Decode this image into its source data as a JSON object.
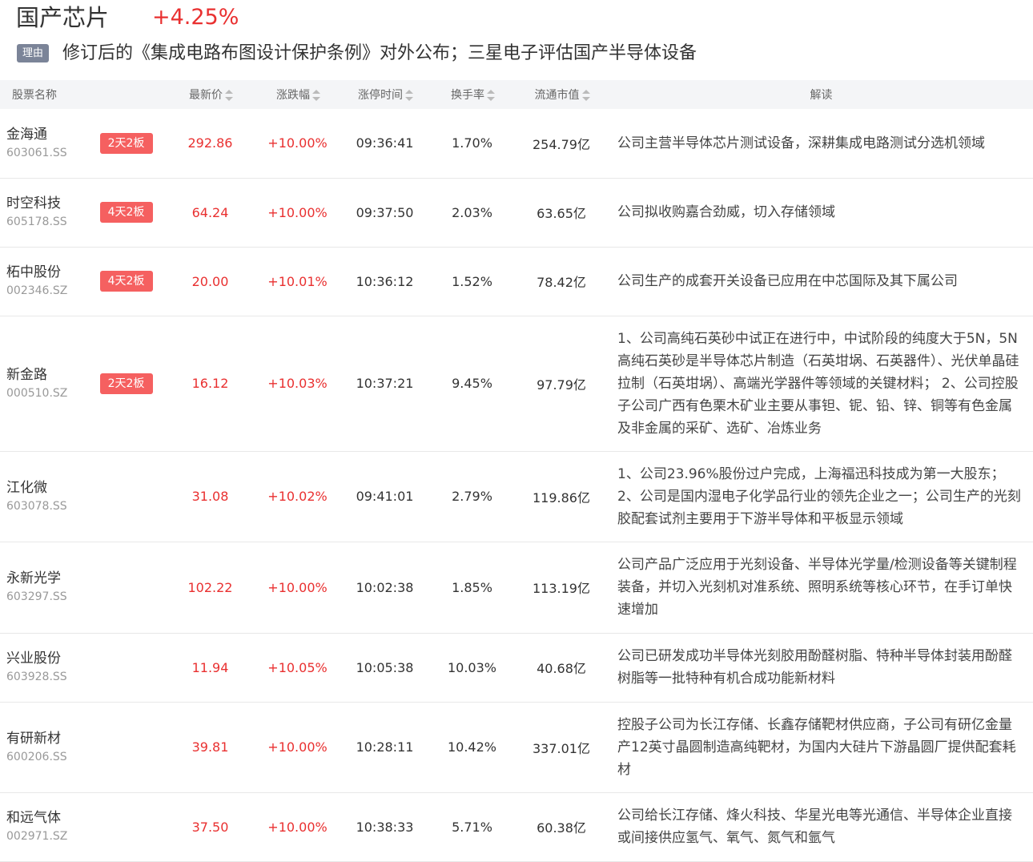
{
  "header": {
    "title": "国产芯片",
    "change": "+4.25%",
    "reason_badge": "理由",
    "reason_text": "修订后的《集成电路布图设计保护条例》对外公布；三星电子评估国产半导体设备"
  },
  "table": {
    "columns": [
      "股票名称",
      "最新价",
      "涨跌幅",
      "涨停时间",
      "换手率",
      "流通市值",
      "解读"
    ],
    "rows": [
      {
        "name": "金海通",
        "code": "603061.SS",
        "board": "2天2板",
        "price": "292.86",
        "change": "+10.00%",
        "time": "09:36:41",
        "turnover": "1.70%",
        "cap": "254.79亿",
        "interp": "公司主营半导体芯片测试设备，深耕集成电路测试分选机领域"
      },
      {
        "name": "时空科技",
        "code": "605178.SS",
        "board": "4天2板",
        "price": "64.24",
        "change": "+10.00%",
        "time": "09:37:50",
        "turnover": "2.03%",
        "cap": "63.65亿",
        "interp": "公司拟收购嘉合劲威，切入存储领域"
      },
      {
        "name": "柘中股份",
        "code": "002346.SZ",
        "board": "4天2板",
        "price": "20.00",
        "change": "+10.01%",
        "time": "10:36:12",
        "turnover": "1.52%",
        "cap": "78.42亿",
        "interp": "公司生产的成套开关设备已应用在中芯国际及其下属公司"
      },
      {
        "name": "新金路",
        "code": "000510.SZ",
        "board": "2天2板",
        "price": "16.12",
        "change": "+10.03%",
        "time": "10:37:21",
        "turnover": "9.45%",
        "cap": "97.79亿",
        "interp": "1、公司高纯石英砂中试正在进行中，中试阶段的纯度大于5N，5N高纯石英砂是半导体芯片制造（石英坩埚、石英器件）、光伏单晶硅拉制（石英坩埚）、高端光学器件等领域的关键材料； 2、公司控股子公司广西有色栗木矿业主要从事钽、铌、铅、锌、铜等有色金属及非金属的采矿、选矿、冶炼业务"
      },
      {
        "name": "江化微",
        "code": "603078.SS",
        "board": "",
        "price": "31.08",
        "change": "+10.02%",
        "time": "09:41:01",
        "turnover": "2.79%",
        "cap": "119.86亿",
        "interp": "1、公司23.96%股份过户完成，上海福迅科技成为第一大股东；2、公司是国内湿电子化学品行业的领先企业之一；公司生产的光刻胶配套试剂主要用于下游半导体和平板显示领域"
      },
      {
        "name": "永新光学",
        "code": "603297.SS",
        "board": "",
        "price": "102.22",
        "change": "+10.00%",
        "time": "10:02:38",
        "turnover": "1.85%",
        "cap": "113.19亿",
        "interp": "公司产品广泛应用于光刻设备、半导体光学量/检测设备等关键制程装备，并切入光刻机对准系统、照明系统等核心环节，在手订单快速增加"
      },
      {
        "name": "兴业股份",
        "code": "603928.SS",
        "board": "",
        "price": "11.94",
        "change": "+10.05%",
        "time": "10:05:38",
        "turnover": "10.03%",
        "cap": "40.68亿",
        "interp": "公司已研发成功半导体光刻胶用酚醛树脂、特种半导体封装用酚醛树脂等一批特种有机合成功能新材料"
      },
      {
        "name": "有研新材",
        "code": "600206.SS",
        "board": "",
        "price": "39.81",
        "change": "+10.00%",
        "time": "10:28:11",
        "turnover": "10.42%",
        "cap": "337.01亿",
        "interp": "控股子公司为长江存储、长鑫存储靶材供应商，子公司有研亿金量产12英寸晶圆制造高纯靶材，为国内大硅片下游晶圆厂提供配套耗材"
      },
      {
        "name": "和远气体",
        "code": "002971.SZ",
        "board": "",
        "price": "37.50",
        "change": "+10.00%",
        "time": "10:38:33",
        "turnover": "5.71%",
        "cap": "60.38亿",
        "interp": "公司给长江存储、烽火科技、华星光电等光通信、半导体企业直接或间接供应氢气、氧气、氮气和氩气"
      }
    ]
  }
}
